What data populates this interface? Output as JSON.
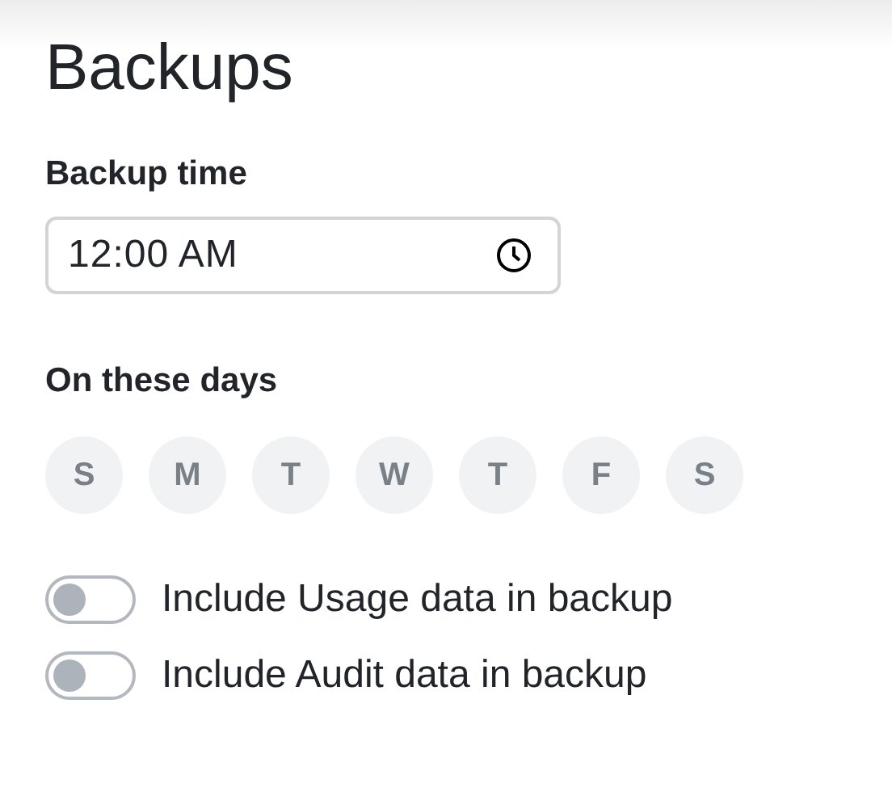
{
  "title": "Backups",
  "backup_time": {
    "label": "Backup time",
    "value": "12:00 AM"
  },
  "days": {
    "label": "On these days",
    "items": [
      {
        "label": "S",
        "selected": false
      },
      {
        "label": "M",
        "selected": false
      },
      {
        "label": "T",
        "selected": false
      },
      {
        "label": "W",
        "selected": false
      },
      {
        "label": "T",
        "selected": false
      },
      {
        "label": "F",
        "selected": false
      },
      {
        "label": "S",
        "selected": false
      }
    ]
  },
  "toggles": [
    {
      "label": "Include Usage data in backup",
      "on": false
    },
    {
      "label": "Include Audit data in backup",
      "on": false
    }
  ]
}
